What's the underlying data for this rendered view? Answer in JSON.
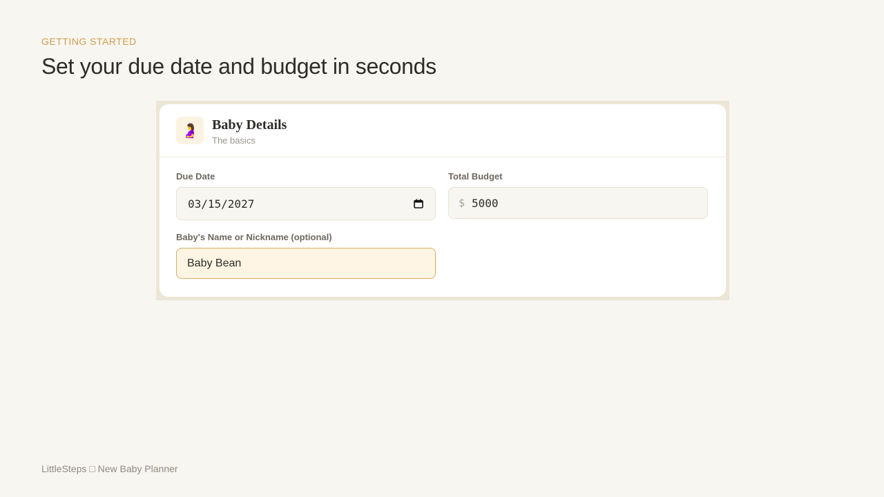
{
  "page": {
    "eyebrow": "GETTING STARTED",
    "headline": "Set your due date and budget in seconds"
  },
  "card": {
    "icon": "pregnant-person-emoji",
    "icon_glyph": "🤰",
    "title": "Baby Details",
    "subtitle": "The basics"
  },
  "form": {
    "due_date": {
      "label": "Due Date",
      "value": "03/15/2027"
    },
    "total_budget": {
      "label": "Total Budget",
      "currency_symbol": "$",
      "value": "5000"
    },
    "baby_name": {
      "label": "Baby's Name or Nickname (optional)",
      "value": "Baby Bean"
    }
  },
  "footer": {
    "text": "LittleSteps □ New Baby Planner"
  },
  "colors": {
    "accent": "#cf9f52",
    "background": "#f8f6f0",
    "focus_border": "#d2ad64",
    "focus_fill": "#fef5e4"
  }
}
